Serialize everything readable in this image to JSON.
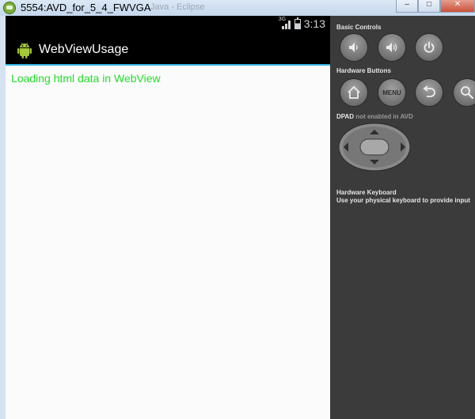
{
  "window": {
    "title": "5554:AVD_for_5_4_FWVGA",
    "ghost_title": "Java - Eclipse",
    "minimize_glyph": "–",
    "maximize_glyph": "□",
    "close_glyph": "✕"
  },
  "statusbar": {
    "network": "3G",
    "time": "3:13"
  },
  "app": {
    "title": "WebViewUsage",
    "webview_text": "Loading html data in WebView"
  },
  "controls": {
    "basic_label": "Basic Controls",
    "hardware_label": "Hardware Buttons",
    "menu_label": "MENU",
    "dpad_label": "DPAD",
    "dpad_note": "not enabled in AVD",
    "keyboard_title": "Hardware Keyboard",
    "keyboard_desc": "Use your physical keyboard to provide input"
  },
  "colors": {
    "accent": "#33b5e5",
    "webview_text": "#22e02a",
    "panel_bg": "#3b3b3b"
  }
}
